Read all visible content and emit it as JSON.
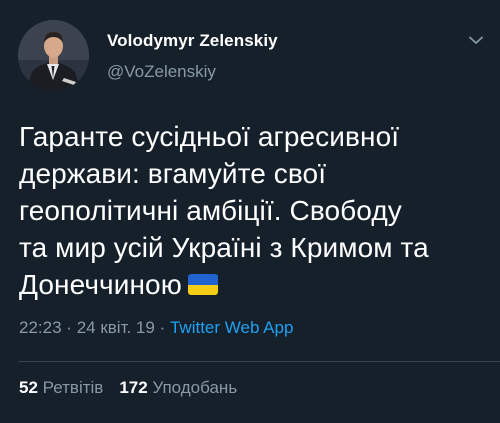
{
  "tweet": {
    "author": {
      "display_name": "Volodymyr Zelenskiy",
      "handle": "@VoZelenskiy",
      "avatar_icon": "profile-photo"
    },
    "more_icon": "chevron-down-icon",
    "text_lines": [
      "Гаранте сусідньої агресивної",
      "держави: вгамуйте свої",
      "геополітичні амбіції. Свободу",
      "та мир усій Україні з Кримом та",
      "Донеччиною"
    ],
    "emoji": "ukraine-flag",
    "time": "22:23",
    "separator1": "·",
    "date": "24 квіт. 19",
    "separator2": "·",
    "source": "Twitter Web App",
    "retweets_count": "52",
    "retweets_label": "Ретвітів",
    "likes_count": "172",
    "likes_label": "Уподобань"
  },
  "colors": {
    "background": "#15202b",
    "secondary_text": "#8899a6",
    "link": "#1da1f2",
    "divider": "#38444d",
    "flag_blue": "#1f64d0",
    "flag_yellow": "#f7cc14"
  }
}
